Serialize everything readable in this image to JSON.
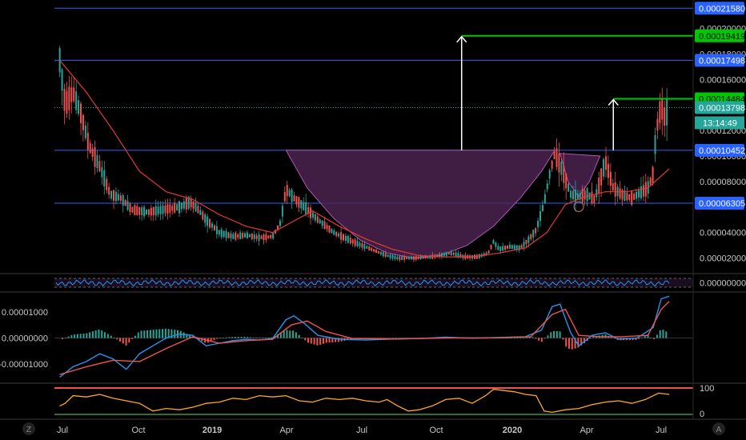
{
  "chart_data": [
    {
      "name": "price-pane",
      "type": "candlestick",
      "title": "",
      "y_scale": "linear",
      "ylim": [
        8.5e-06,
        0.000221
      ],
      "y_ticks": [
        "0.00020000",
        "0.00018000",
        "0.00016000",
        "0.00012000",
        "0.00010000",
        "0.00008000",
        "0.00004000",
        "0.00002000"
      ],
      "horizontal_levels": [
        {
          "label": "0.00021580",
          "value": 0.0002158,
          "color": "#2962ff"
        },
        {
          "label": "0.00017498",
          "value": 0.00017498,
          "color": "#2962ff"
        },
        {
          "label": "0.00010452",
          "value": 0.00010452,
          "color": "#2962ff"
        },
        {
          "label": "0.00006305",
          "value": 6.305e-05,
          "color": "#2962ff"
        }
      ],
      "target_levels": [
        {
          "label": "0.00019419",
          "value": 0.00019419,
          "color": "#00c800"
        },
        {
          "label": "0.00014484",
          "value": 0.00014484,
          "color": "#00c800"
        }
      ],
      "last_price": {
        "label": "0.00013798",
        "value": 0.00013798,
        "countdown": "13:14:49",
        "color": "#26a69a"
      },
      "x_ticks": [
        "Jul",
        "Oct",
        "2019",
        "Apr",
        "Jul",
        "Oct",
        "2020",
        "Apr",
        "Jul"
      ],
      "price_path": [
        [
          2018.45,
          0.000175
        ],
        [
          2018.47,
          0.00014
        ],
        [
          2018.5,
          0.00015
        ],
        [
          2018.53,
          0.000133
        ],
        [
          2018.56,
          0.000108
        ],
        [
          2018.6,
          9.2e-05
        ],
        [
          2018.64,
          7e-05
        ],
        [
          2018.68,
          6.7e-05
        ],
        [
          2018.72,
          5.8e-05
        ],
        [
          2018.78,
          5.6e-05
        ],
        [
          2018.84,
          5.8e-05
        ],
        [
          2018.9,
          6e-05
        ],
        [
          2018.94,
          6.4e-05
        ],
        [
          2018.97,
          5.8e-05
        ],
        [
          2019.0,
          5e-05
        ],
        [
          2019.05,
          4e-05
        ],
        [
          2019.1,
          3.7e-05
        ],
        [
          2019.15,
          3.8e-05
        ],
        [
          2019.2,
          3.6e-05
        ],
        [
          2019.25,
          3.7e-05
        ],
        [
          2019.28,
          4.8e-05
        ],
        [
          2019.3,
          7.4e-05
        ],
        [
          2019.33,
          6.7e-05
        ],
        [
          2019.37,
          6e-05
        ],
        [
          2019.42,
          5e-05
        ],
        [
          2019.48,
          4e-05
        ],
        [
          2019.55,
          3.3e-05
        ],
        [
          2019.62,
          2.7e-05
        ],
        [
          2019.68,
          2.2e-05
        ],
        [
          2019.72,
          2e-05
        ],
        [
          2019.78,
          2e-05
        ],
        [
          2019.85,
          2.1e-05
        ],
        [
          2019.92,
          2.4e-05
        ],
        [
          2019.97,
          2.1e-05
        ],
        [
          2020.02,
          2.1e-05
        ],
        [
          2020.06,
          2.4e-05
        ],
        [
          2020.08,
          3.3e-05
        ],
        [
          2020.1,
          2.7e-05
        ],
        [
          2020.14,
          2.9e-05
        ],
        [
          2020.18,
          2.8e-05
        ],
        [
          2020.21,
          3.4e-05
        ],
        [
          2020.24,
          4.2e-05
        ],
        [
          2020.27,
          6.3e-05
        ],
        [
          2020.29,
          8.5e-05
        ],
        [
          2020.31,
          0.000102
        ],
        [
          2020.34,
          8.8e-05
        ],
        [
          2020.37,
          7e-05
        ],
        [
          2020.4,
          6.8e-05
        ],
        [
          2020.43,
          7e-05
        ],
        [
          2020.46,
          6.6e-05
        ],
        [
          2020.48,
          8e-05
        ],
        [
          2020.5,
          9.6e-05
        ],
        [
          2020.53,
          7.5e-05
        ],
        [
          2020.56,
          7e-05
        ],
        [
          2020.6,
          6.7e-05
        ],
        [
          2020.63,
          7.1e-05
        ],
        [
          2020.66,
          7.5e-05
        ],
        [
          2020.68,
          8.6e-05
        ],
        [
          2020.69,
          0.000118
        ],
        [
          2020.71,
          0.00014
        ],
        [
          2020.72,
          0.00013
        ],
        [
          2020.74,
          0.000138
        ]
      ],
      "ma_path": [
        [
          2018.45,
          0.000175
        ],
        [
          2018.55,
          0.00015
        ],
        [
          2018.65,
          0.00012
        ],
        [
          2018.75,
          8.8e-05
        ],
        [
          2018.85,
          7.2e-05
        ],
        [
          2018.95,
          6.6e-05
        ],
        [
          2019.05,
          5.4e-05
        ],
        [
          2019.15,
          4.5e-05
        ],
        [
          2019.25,
          4e-05
        ],
        [
          2019.32,
          4.8e-05
        ],
        [
          2019.4,
          5.7e-05
        ],
        [
          2019.5,
          4.5e-05
        ],
        [
          2019.6,
          3.5e-05
        ],
        [
          2019.7,
          2.7e-05
        ],
        [
          2019.8,
          2.2e-05
        ],
        [
          2019.9,
          2.1e-05
        ],
        [
          2020.0,
          2.1e-05
        ],
        [
          2020.1,
          2.4e-05
        ],
        [
          2020.2,
          2.8e-05
        ],
        [
          2020.28,
          4e-05
        ],
        [
          2020.35,
          6.2e-05
        ],
        [
          2020.42,
          6.8e-05
        ],
        [
          2020.5,
          7.2e-05
        ],
        [
          2020.58,
          7.2e-05
        ],
        [
          2020.66,
          7.5e-05
        ],
        [
          2020.74,
          9e-05
        ]
      ],
      "cup_curve": [
        [
          2019.3,
          0.00010452
        ],
        [
          2019.38,
          7.5e-05
        ],
        [
          2019.48,
          5.1e-05
        ],
        [
          2019.58,
          3.4e-05
        ],
        [
          2019.68,
          2.4e-05
        ],
        [
          2019.78,
          2e-05
        ],
        [
          2019.88,
          2.2e-05
        ],
        [
          2019.98,
          3e-05
        ],
        [
          2020.08,
          4.5e-05
        ],
        [
          2020.18,
          6.7e-05
        ],
        [
          2020.26,
          8.8e-05
        ],
        [
          2020.31,
          0.00010452
        ]
      ],
      "handle_curve": [
        [
          2020.33,
          0.000102
        ],
        [
          2020.36,
          8e-05
        ],
        [
          2020.4,
          6.8e-05
        ],
        [
          2020.44,
          8e-05
        ],
        [
          2020.48,
          0.0001
        ]
      ],
      "measured_moves": [
        {
          "x": 2019.96,
          "from": 0.00010452,
          "to": 0.00019419
        },
        {
          "x": 2020.53,
          "from": 0.00010452,
          "to": 0.00014484
        }
      ]
    },
    {
      "name": "rsi-pane",
      "type": "line",
      "label": "0.00000000",
      "band": [
        30,
        70
      ],
      "values_note": ""
    },
    {
      "name": "macd-pane",
      "type": "line",
      "y_ticks": [
        "0.00001000",
        "0.00000000",
        "-0.00001000"
      ],
      "ylim": [
        -1.7e-05,
        1.7e-05
      ],
      "macd": [
        [
          2018.45,
          -1.5e-05
        ],
        [
          2018.5,
          -1.1e-05
        ],
        [
          2018.55,
          -9e-06
        ],
        [
          2018.6,
          -6e-06
        ],
        [
          2018.65,
          -8e-06
        ],
        [
          2018.7,
          -1.2e-05
        ],
        [
          2018.75,
          -6e-06
        ],
        [
          2018.8,
          -3e-06
        ],
        [
          2018.85,
          0.0
        ],
        [
          2018.9,
          1.5e-06
        ],
        [
          2018.95,
          1e-06
        ],
        [
          2019.0,
          -3e-06
        ],
        [
          2019.05,
          -2e-06
        ],
        [
          2019.1,
          -1e-06
        ],
        [
          2019.15,
          -5e-07
        ],
        [
          2019.2,
          -8e-07
        ],
        [
          2019.25,
          -2e-07
        ],
        [
          2019.3,
          7e-06
        ],
        [
          2019.33,
          8.5e-06
        ],
        [
          2019.37,
          5.5e-06
        ],
        [
          2019.42,
          1e-06
        ],
        [
          2019.5,
          -5e-07
        ],
        [
          2019.6,
          -8e-07
        ],
        [
          2019.7,
          -4e-07
        ],
        [
          2019.8,
          -2e-07
        ],
        [
          2019.9,
          3e-07
        ],
        [
          2020.0,
          -1e-07
        ],
        [
          2020.1,
          2e-07
        ],
        [
          2020.2,
          5e-07
        ],
        [
          2020.26,
          3e-06
        ],
        [
          2020.3,
          1.2e-05
        ],
        [
          2020.33,
          1.3e-05
        ],
        [
          2020.37,
          2e-06
        ],
        [
          2020.4,
          -3e-06
        ],
        [
          2020.45,
          1e-06
        ],
        [
          2020.5,
          2e-06
        ],
        [
          2020.55,
          -5e-07
        ],
        [
          2020.62,
          0.0
        ],
        [
          2020.68,
          4e-06
        ],
        [
          2020.71,
          1.5e-05
        ],
        [
          2020.74,
          1.6e-05
        ]
      ],
      "signal": [
        [
          2018.45,
          -1.4e-05
        ],
        [
          2018.55,
          -1.1e-05
        ],
        [
          2018.65,
          -8.5e-06
        ],
        [
          2018.75,
          -9e-06
        ],
        [
          2018.85,
          -4e-06
        ],
        [
          2018.95,
          5e-07
        ],
        [
          2019.05,
          -2e-06
        ],
        [
          2019.15,
          -1e-06
        ],
        [
          2019.25,
          -5e-07
        ],
        [
          2019.32,
          5e-06
        ],
        [
          2019.38,
          6.5e-06
        ],
        [
          2019.45,
          2.5e-06
        ],
        [
          2019.55,
          -2e-07
        ],
        [
          2019.7,
          -4e-07
        ],
        [
          2019.9,
          0.0
        ],
        [
          2020.1,
          1e-07
        ],
        [
          2020.22,
          5e-07
        ],
        [
          2020.3,
          9e-06
        ],
        [
          2020.35,
          1.1e-05
        ],
        [
          2020.4,
          1e-06
        ],
        [
          2020.48,
          5e-07
        ],
        [
          2020.56,
          5e-07
        ],
        [
          2020.66,
          1e-06
        ],
        [
          2020.71,
          1.1e-05
        ],
        [
          2020.74,
          1.4e-05
        ]
      ]
    },
    {
      "name": "oscillator-pane",
      "type": "line",
      "y_ticks": [
        "100",
        "0"
      ],
      "ylim": [
        0,
        100
      ],
      "upper_band": 100,
      "lower_band": 0,
      "values": [
        [
          2018.45,
          30
        ],
        [
          2018.47,
          40
        ],
        [
          2018.5,
          70
        ],
        [
          2018.55,
          65
        ],
        [
          2018.6,
          75
        ],
        [
          2018.65,
          60
        ],
        [
          2018.7,
          50
        ],
        [
          2018.75,
          40
        ],
        [
          2018.8,
          10
        ],
        [
          2018.85,
          20
        ],
        [
          2018.9,
          15
        ],
        [
          2018.95,
          25
        ],
        [
          2019.0,
          40
        ],
        [
          2019.05,
          45
        ],
        [
          2019.1,
          60
        ],
        [
          2019.15,
          55
        ],
        [
          2019.2,
          70
        ],
        [
          2019.25,
          65
        ],
        [
          2019.3,
          70
        ],
        [
          2019.35,
          50
        ],
        [
          2019.4,
          45
        ],
        [
          2019.45,
          60
        ],
        [
          2019.5,
          55
        ],
        [
          2019.55,
          60
        ],
        [
          2019.6,
          50
        ],
        [
          2019.65,
          45
        ],
        [
          2019.68,
          55
        ],
        [
          2019.72,
          30
        ],
        [
          2019.76,
          10
        ],
        [
          2019.8,
          15
        ],
        [
          2019.85,
          30
        ],
        [
          2019.9,
          55
        ],
        [
          2019.95,
          60
        ],
        [
          2020.0,
          40
        ],
        [
          2020.05,
          70
        ],
        [
          2020.08,
          95
        ],
        [
          2020.12,
          90
        ],
        [
          2020.16,
          85
        ],
        [
          2020.2,
          75
        ],
        [
          2020.24,
          70
        ],
        [
          2020.27,
          10
        ],
        [
          2020.3,
          5
        ],
        [
          2020.35,
          15
        ],
        [
          2020.4,
          20
        ],
        [
          2020.45,
          35
        ],
        [
          2020.5,
          45
        ],
        [
          2020.55,
          50
        ],
        [
          2020.6,
          40
        ],
        [
          2020.65,
          55
        ],
        [
          2020.7,
          80
        ],
        [
          2020.74,
          75
        ]
      ]
    }
  ],
  "ui": {
    "countdown": "13:14:49",
    "corner_left": "Z",
    "corner_right": "A"
  },
  "colors": {
    "grid_line": "#1e2a44",
    "level_line": "#2962ff",
    "target_line": "#00c800",
    "candle_up": "#26a69a",
    "candle_down": "#ef5350",
    "ma_line": "#e53935",
    "cup_fill": "#4b2350",
    "cup_stroke": "#b055b6",
    "macd_line": "#2196f3",
    "signal_line": "#ef5350",
    "osc_line": "#ffa726",
    "osc_upper": "#ef5350",
    "osc_lower": "#4caf50",
    "arrow": "#ffffff"
  }
}
